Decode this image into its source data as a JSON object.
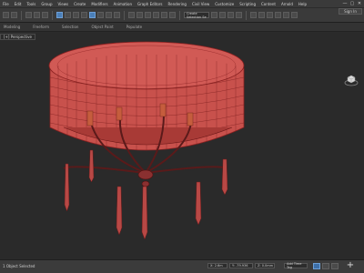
{
  "menu": [
    "File",
    "Edit",
    "Tools",
    "Group",
    "Views",
    "Create",
    "Modifiers",
    "Animation",
    "Graph Editors",
    "Rendering",
    "Civil View",
    "Customize",
    "Scripting",
    "Content",
    "Arnold",
    "Help"
  ],
  "window": {
    "minimize": "—",
    "maximize": "▢",
    "close": "✕"
  },
  "signin": "Sign In",
  "toolbar": {
    "selection_set": "Create Selection Se"
  },
  "ribbon_tabs": [
    "Modeling",
    "Freeform",
    "Selection",
    "Object Paint",
    "Populate"
  ],
  "viewport": {
    "label": "[+] Perspective"
  },
  "status": {
    "left_text": "1 Object Selected",
    "x": "X: 2.6m",
    "y": "Y: -79.936",
    "z": "Z: 0.0mm",
    "add_time_tag": "Add Time Tag"
  },
  "colors": {
    "mesh": "#c8514c",
    "wire": "#8a2020",
    "bg": "#2a2a2a",
    "chrome": "#3a3a3a",
    "accent": "#4a7fb8"
  },
  "icons": [
    "undo-icon",
    "redo-icon",
    "link-icon",
    "select-icon",
    "move-icon",
    "rotate-icon",
    "scale-icon",
    "snap-icon",
    "render-icon",
    "viewcube-icon",
    "play-icon",
    "key-icon"
  ]
}
